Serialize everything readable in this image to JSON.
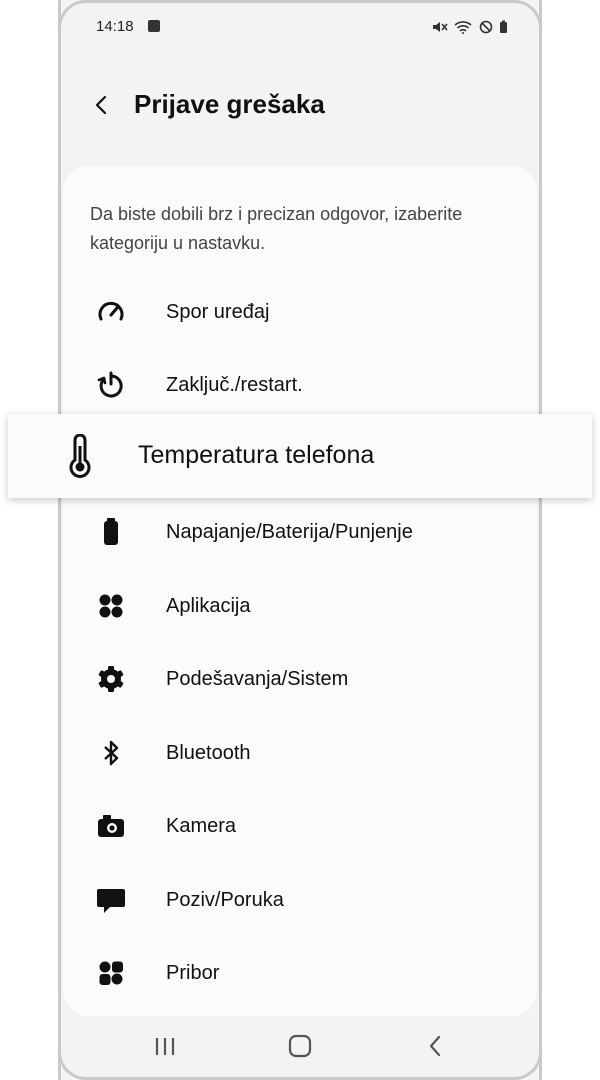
{
  "status_bar": {
    "time": "14:18",
    "icons": [
      "notification-check-icon",
      "mute-icon",
      "wifi-icon",
      "do-not-disturb-icon",
      "battery-icon"
    ]
  },
  "header": {
    "back_icon": "chevron-left-icon",
    "title": "Prijave grešaka"
  },
  "intro": "Da biste dobili brz i precizan odgovor, izaberite kategoriju u nastavku.",
  "categories": [
    {
      "icon": "speedometer-icon",
      "label": "Spor uređaj"
    },
    {
      "icon": "restart-icon",
      "label": "Zaključ./restart."
    },
    {
      "icon": "thermometer-icon",
      "label": "Temperatura telefona",
      "highlighted": true
    },
    {
      "icon": "battery-icon",
      "label": "Napajanje/Baterija/Punjenje"
    },
    {
      "icon": "apps-icon",
      "label": "Aplikacija"
    },
    {
      "icon": "gear-icon",
      "label": "Podešavanja/Sistem"
    },
    {
      "icon": "bluetooth-icon",
      "label": "Bluetooth"
    },
    {
      "icon": "camera-icon",
      "label": "Kamera"
    },
    {
      "icon": "message-icon",
      "label": "Poziv/Poruka"
    },
    {
      "icon": "accessories-icon",
      "label": "Pribor"
    }
  ],
  "navbar": [
    "recents-icon",
    "home-icon",
    "back-icon"
  ],
  "colors": {
    "background": "#f3f3f3",
    "card": "#fbfbfb",
    "text": "#111111",
    "frame": "#c9c9c9"
  }
}
